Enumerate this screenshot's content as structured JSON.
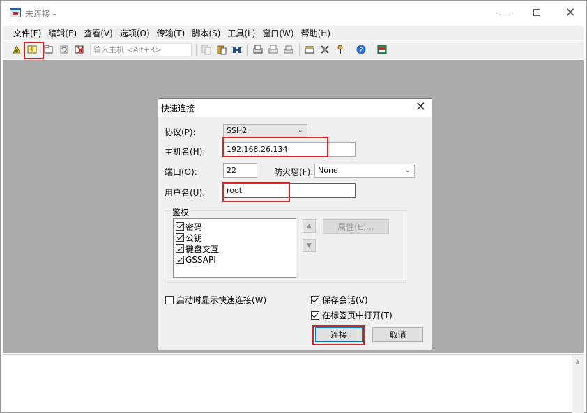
{
  "window": {
    "title": "未连接 - "
  },
  "menu": [
    "文件(F)",
    "编辑(E)",
    "查看(V)",
    "选项(O)",
    "传输(T)",
    "脚本(S)",
    "工具(L)",
    "窗口(W)",
    "帮助(H)"
  ],
  "toolbar": {
    "quick_connect_placeholder": "输入主机 <Alt+R>",
    "icons": [
      "connect-icon",
      "quick-connect-icon",
      "connect-in-tab-icon",
      "reconnect-icon",
      "disconnect-icon",
      "copy-icon",
      "paste-icon",
      "find-icon",
      "print-setup-icon",
      "print-icon",
      "print-screen-icon",
      "session-options-icon",
      "global-options-icon",
      "key-icon",
      "help-icon",
      "sftp-icon"
    ]
  },
  "dialog": {
    "title": "快速连接",
    "protocol_label": "协议(P):",
    "protocol_value": "SSH2",
    "hostname_label": "主机名(H):",
    "hostname_value": "192.168.26.134",
    "port_label": "端口(O):",
    "port_value": "22",
    "firewall_label": "防火墙(F):",
    "firewall_value": "None",
    "username_label": "用户名(U):",
    "username_value": "root",
    "auth_group_label": "鉴权",
    "auth_methods": [
      {
        "label": "密码",
        "checked": true
      },
      {
        "label": "公钥",
        "checked": true
      },
      {
        "label": "键盘交互",
        "checked": true
      },
      {
        "label": "GSSAPI",
        "checked": true
      }
    ],
    "properties_button": "属性(E)...",
    "show_on_startup_label": "启动时显示快速连接(W)",
    "show_on_startup_checked": false,
    "save_session_label": "保存会话(V)",
    "save_session_checked": true,
    "open_in_tab_label": "在标签页中打开(T)",
    "open_in_tab_checked": true,
    "connect_button": "连接",
    "cancel_button": "取消"
  }
}
